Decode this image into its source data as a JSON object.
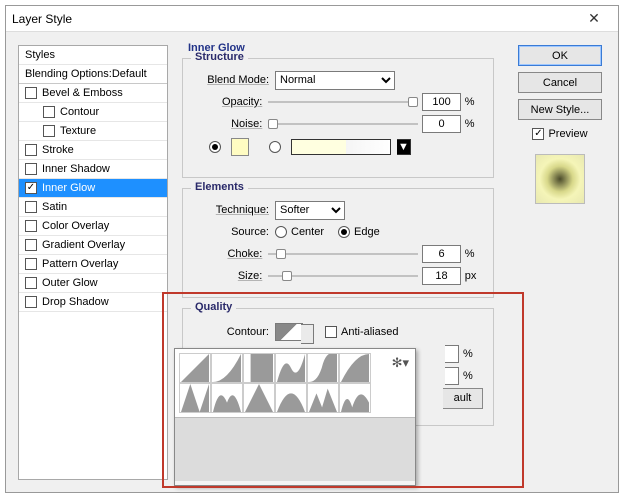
{
  "window": {
    "title": "Layer Style",
    "close": "✕"
  },
  "styles": {
    "header": "Styles",
    "blending": "Blending Options:Default",
    "items": [
      {
        "label": "Bevel & Emboss",
        "checked": false,
        "indent": false
      },
      {
        "label": "Contour",
        "checked": false,
        "indent": true
      },
      {
        "label": "Texture",
        "checked": false,
        "indent": true
      },
      {
        "label": "Stroke",
        "checked": false,
        "indent": false
      },
      {
        "label": "Inner Shadow",
        "checked": false,
        "indent": false
      },
      {
        "label": "Inner Glow",
        "checked": true,
        "indent": false,
        "selected": true
      },
      {
        "label": "Satin",
        "checked": false,
        "indent": false
      },
      {
        "label": "Color Overlay",
        "checked": false,
        "indent": false
      },
      {
        "label": "Gradient Overlay",
        "checked": false,
        "indent": false
      },
      {
        "label": "Pattern Overlay",
        "checked": false,
        "indent": false
      },
      {
        "label": "Outer Glow",
        "checked": false,
        "indent": false
      },
      {
        "label": "Drop Shadow",
        "checked": false,
        "indent": false
      }
    ]
  },
  "panel_title": "Inner Glow",
  "structure": {
    "legend": "Structure",
    "blend_mode_label": "Blend Mode:",
    "blend_mode_value": "Normal",
    "opacity_label": "Opacity:",
    "opacity_value": "100",
    "opacity_unit": "%",
    "noise_label": "Noise:",
    "noise_value": "0",
    "noise_unit": "%",
    "color_hex": "#fffcc2",
    "gradient_selected": false
  },
  "elements": {
    "legend": "Elements",
    "technique_label": "Technique:",
    "technique_value": "Softer",
    "source_label": "Source:",
    "source_center": "Center",
    "source_edge": "Edge",
    "source_value": "Edge",
    "choke_label": "Choke:",
    "choke_value": "6",
    "choke_unit": "%",
    "size_label": "Size:",
    "size_value": "18",
    "size_unit": "px"
  },
  "quality": {
    "legend": "Quality",
    "contour_label": "Contour:",
    "anti_aliased_label": "Anti-aliased",
    "anti_aliased": false,
    "range_unit": "%",
    "jitter_unit": "%",
    "default_btn": "ault"
  },
  "buttons": {
    "ok": "OK",
    "cancel": "Cancel",
    "new_style": "New Style...",
    "preview_label": "Preview",
    "preview_checked": true
  },
  "popup": {
    "gear": "✻▾"
  }
}
